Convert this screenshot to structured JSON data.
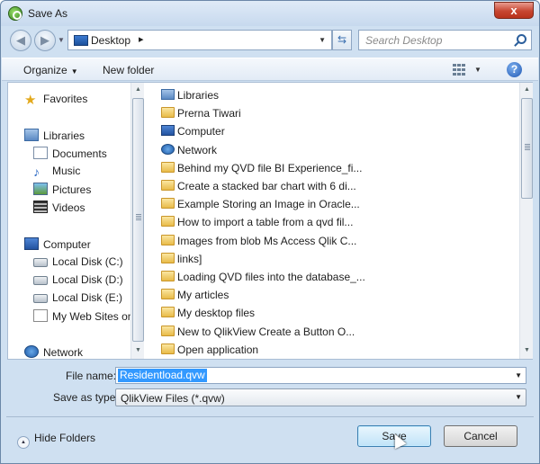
{
  "window": {
    "title": "Save As",
    "close_label": "x"
  },
  "nav": {
    "address": "Desktop",
    "address_chevron": "▸",
    "search_placeholder": "Search Desktop"
  },
  "toolbar": {
    "organize": "Organize",
    "new_folder": "New folder",
    "help": "?"
  },
  "sidebar": {
    "favorites": "Favorites",
    "libraries": "Libraries",
    "library_items": [
      "Documents",
      "Music",
      "Pictures",
      "Videos"
    ],
    "computer": "Computer",
    "computer_items": [
      "Local Disk (C:)",
      "Local Disk (D:)",
      "Local Disk (E:)",
      "My Web Sites on"
    ],
    "network": "Network"
  },
  "files": [
    "Libraries",
    "Prerna Tiwari",
    "Computer",
    "Network",
    "Behind my QVD file  BI Experience_fi...",
    "Create a stacked bar chart with 6 di...",
    "Example  Storing an Image in Oracle...",
    "How to import a table from a qvd fil...",
    "Images from blob Ms Access   Qlik C...",
    "links]",
    "Loading QVD files into the database_...",
    "My articles",
    "My desktop files",
    "New to QlikView  Create a Button O...",
    "Open application"
  ],
  "form": {
    "filename_label": "File name:",
    "filename_value": "Residentload.qvw",
    "savetype_label": "Save as type:",
    "savetype_value": "QlikView Files (*.qvw)"
  },
  "footer": {
    "hide_folders": "Hide Folders",
    "save": "Save",
    "cancel": "Cancel"
  },
  "colors": {
    "selection": "#3399ff",
    "window_frame": "#cfe0f1"
  }
}
